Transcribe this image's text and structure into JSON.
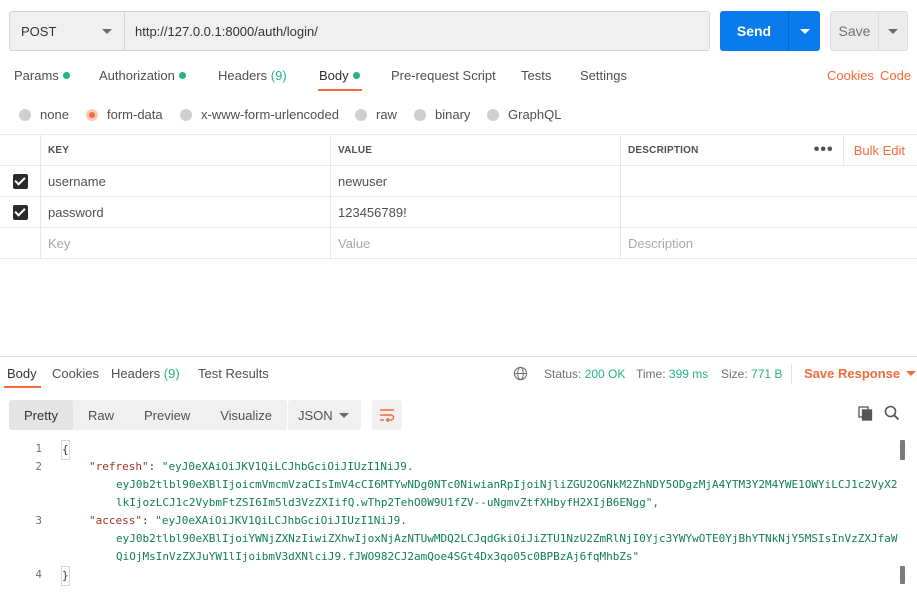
{
  "request": {
    "method": "POST",
    "url": "http://127.0.0.1:8000/auth/login/",
    "send_label": "Send",
    "save_label": "Save"
  },
  "req_tabs": {
    "params": "Params",
    "authorization": "Authorization",
    "headers": "Headers",
    "headers_count": "(9)",
    "body": "Body",
    "prerequest": "Pre-request Script",
    "tests": "Tests",
    "settings": "Settings",
    "cookies": "Cookies",
    "code": "Code"
  },
  "body_types": {
    "none": "none",
    "form_data": "form-data",
    "urlencoded": "x-www-form-urlencoded",
    "raw": "raw",
    "binary": "binary",
    "graphql": "GraphQL",
    "selected": "form-data"
  },
  "params_table": {
    "headers": {
      "key": "KEY",
      "value": "VALUE",
      "description": "DESCRIPTION",
      "bulk_edit": "Bulk Edit"
    },
    "rows": [
      {
        "key": "username",
        "value": "newuser",
        "checked": true
      },
      {
        "key": "password",
        "value": "123456789!",
        "checked": true
      }
    ],
    "placeholders": {
      "key": "Key",
      "value": "Value",
      "description": "Description"
    }
  },
  "response": {
    "tabs": {
      "body": "Body",
      "cookies": "Cookies",
      "headers": "Headers",
      "headers_count": "(9)",
      "test_results": "Test Results"
    },
    "status_label": "Status:",
    "status": "200 OK",
    "time_label": "Time:",
    "time": "399 ms",
    "size_label": "Size:",
    "size": "771 B",
    "save_response": "Save Response",
    "views": {
      "pretty": "Pretty",
      "raw": "Raw",
      "preview": "Preview",
      "visualize": "Visualize"
    },
    "format": "JSON",
    "code": {
      "line1": "{",
      "line2_key": "\"refresh\"",
      "line2_val_a": "\"eyJ0eXAiOiJKV1QiLCJhbGciOiJIUzI1NiJ9.",
      "line2_val_b": "eyJ0b2tlbl90eXBlIjoicmVmcmVzaCIsImV4cCI6MTYwNDg0NTc0NiwianRpIjoiNjliZGU2OGNkM2ZhNDY5ODgzMjA4YTM3Y2M4YWE1OWYiLCJ1c2VyX2",
      "line2_val_c": "lkIjozLCJ1c2VybmFtZSI6Im5ld3VzZXIifQ.wThp2TehO0W9U1fZV--uNgmvZtfXHbyfH2XIjB6ENgg\",",
      "line3_key": "\"access\"",
      "line3_val_a": "\"eyJ0eXAiOiJKV1QiLCJhbGciOiJIUzI1NiJ9.",
      "line3_val_b": "eyJ0b2tlbl90eXBlIjoiYWNjZXNzIiwiZXhwIjoxNjAzNTUwMDQ2LCJqdGkiOiJiZTU1NzU2ZmRlNjI0Yjc3YWYwOTE0YjBhYTNkNjY5MSIsInVzZXJfaW",
      "line3_val_c": "QiOjMsInVzZXJuYW1lIjoibmV3dXNlciJ9.fJWO982CJ2amQoe4SGt4Dx3qo05c0BPBzAj6fqMhbZs\"",
      "line4": "}",
      "nums": [
        "1",
        "2",
        "3",
        "4"
      ]
    }
  },
  "colors": {
    "accent": "#f26b3a",
    "send": "#097bed",
    "ok": "#26b47f"
  }
}
